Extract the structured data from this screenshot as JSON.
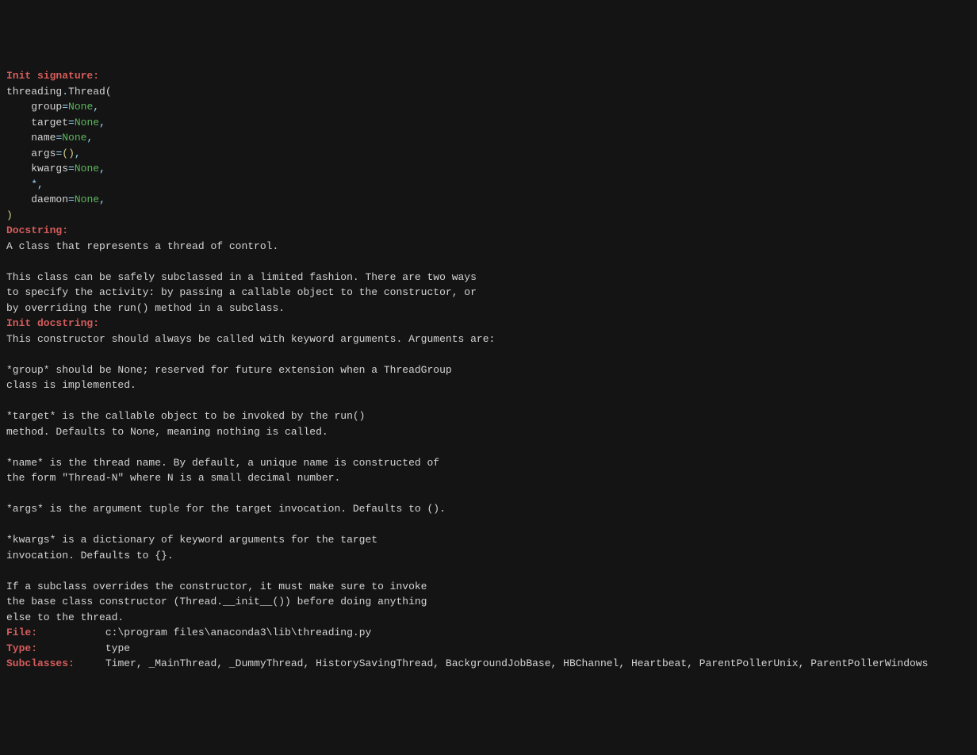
{
  "headers": {
    "init_signature": "Init signature:",
    "docstring": "Docstring:",
    "init_docstring": "Init docstring:",
    "file": "File:",
    "type": "Type:",
    "subclasses": "Subclasses:"
  },
  "signature": {
    "class_prefix": "threading",
    "dot": ".",
    "class_name": "Thread",
    "open_paren": "(",
    "params": [
      {
        "name": "group",
        "eq": "=",
        "value": "None",
        "comma": ","
      },
      {
        "name": "target",
        "eq": "=",
        "value": "None",
        "comma": ","
      },
      {
        "name": "name",
        "eq": "=",
        "value": "None",
        "comma": ","
      },
      {
        "name": "args",
        "eq": "=",
        "open": "(",
        "close": ")",
        "comma": ","
      },
      {
        "name": "kwargs",
        "eq": "=",
        "value": "None",
        "comma": ","
      },
      {
        "name": "*",
        "comma": ","
      },
      {
        "name": "daemon",
        "eq": "=",
        "value": "None",
        "comma": ","
      }
    ],
    "close_paren": ")"
  },
  "docstring_lines": [
    "A class that represents a thread of control.",
    "",
    "This class can be safely subclassed in a limited fashion. There are two ways",
    "to specify the activity: by passing a callable object to the constructor, or",
    "by overriding the run() method in a subclass."
  ],
  "init_docstring_lines": [
    "This constructor should always be called with keyword arguments. Arguments are:",
    "",
    "*group* should be None; reserved for future extension when a ThreadGroup",
    "class is implemented.",
    "",
    "*target* is the callable object to be invoked by the run()",
    "method. Defaults to None, meaning nothing is called.",
    "",
    "*name* is the thread name. By default, a unique name is constructed of",
    "the form \"Thread-N\" where N is a small decimal number.",
    "",
    "*args* is the argument tuple for the target invocation. Defaults to ().",
    "",
    "*kwargs* is a dictionary of keyword arguments for the target",
    "invocation. Defaults to {}.",
    "",
    "If a subclass overrides the constructor, it must make sure to invoke",
    "the base class constructor (Thread.__init__()) before doing anything",
    "else to the thread."
  ],
  "footer": {
    "file_value": "c:\\program files\\anaconda3\\lib\\threading.py",
    "type_value": "type",
    "subclasses_value": "Timer, _MainThread, _DummyThread, HistorySavingThread, BackgroundJobBase, HBChannel, Heartbeat, ParentPollerUnix, ParentPollerWindows"
  }
}
